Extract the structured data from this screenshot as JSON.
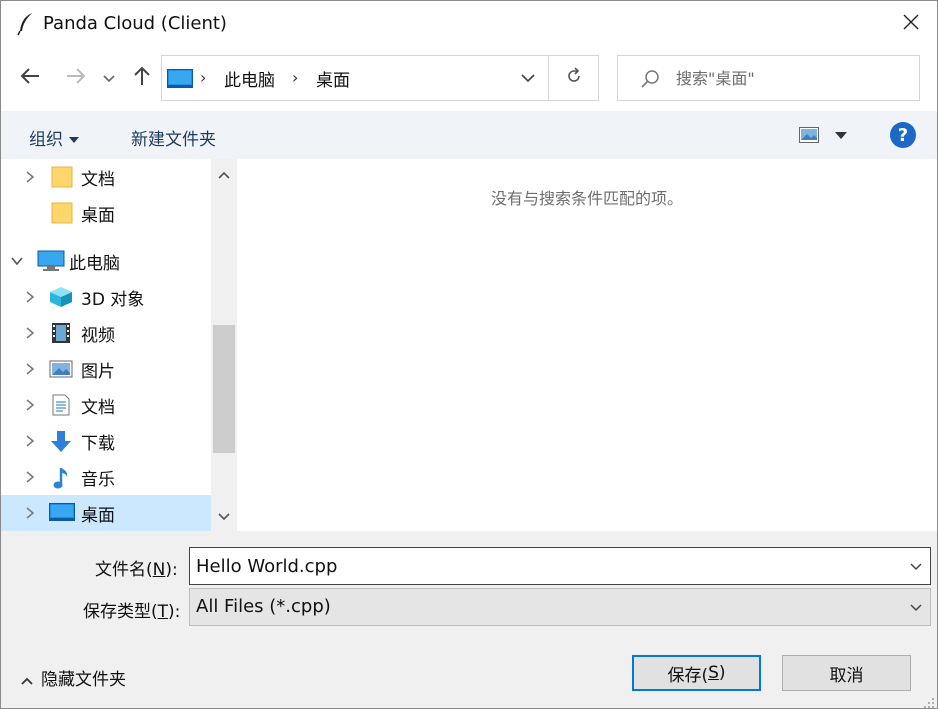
{
  "window": {
    "title": "Panda Cloud (Client)"
  },
  "address_bar": {
    "crumbs": [
      "此电脑",
      "桌面"
    ],
    "separator": "›"
  },
  "search": {
    "placeholder": "搜索\"桌面\""
  },
  "command_bar": {
    "organize_label": "组织",
    "new_folder_label": "新建文件夹",
    "help_label": "?"
  },
  "nav_tree": {
    "items": [
      {
        "label": "文档",
        "icon": "folder-icon",
        "expandable": true
      },
      {
        "label": "桌面",
        "icon": "folder-icon",
        "expandable": false
      },
      {
        "label": "此电脑",
        "icon": "computer-icon",
        "expanded": true
      },
      {
        "label": "3D 对象",
        "icon": "cube-3d-icon",
        "expandable": true
      },
      {
        "label": "视频",
        "icon": "video-icon",
        "expandable": true
      },
      {
        "label": "图片",
        "icon": "picture-icon",
        "expandable": true
      },
      {
        "label": "文档",
        "icon": "document-icon",
        "expandable": true
      },
      {
        "label": "下载",
        "icon": "download-icon",
        "expandable": true
      },
      {
        "label": "音乐",
        "icon": "music-icon",
        "expandable": true
      },
      {
        "label": "桌面",
        "icon": "desktop-icon",
        "expandable": true,
        "selected": true
      }
    ]
  },
  "content": {
    "empty_message": "没有与搜索条件匹配的项。"
  },
  "form": {
    "filename_label_pre": "文件名(",
    "filename_label_key": "N",
    "filename_label_post": "):",
    "filename_value": "Hello World.cpp",
    "filetype_label_pre": "保存类型(",
    "filetype_label_key": "T",
    "filetype_label_post": "):",
    "filetype_value": "All Files (*.cpp)"
  },
  "footer": {
    "hide_folders_label": "隐藏文件夹",
    "save_label_pre": "保存(",
    "save_label_key": "S",
    "save_label_post": ")",
    "cancel_label": "取消"
  },
  "colors": {
    "accent": "#0078d7",
    "selected_bg": "#cce8ff",
    "command_bar_bg": "#f0f4f9",
    "help_blue": "#1c68c9"
  }
}
